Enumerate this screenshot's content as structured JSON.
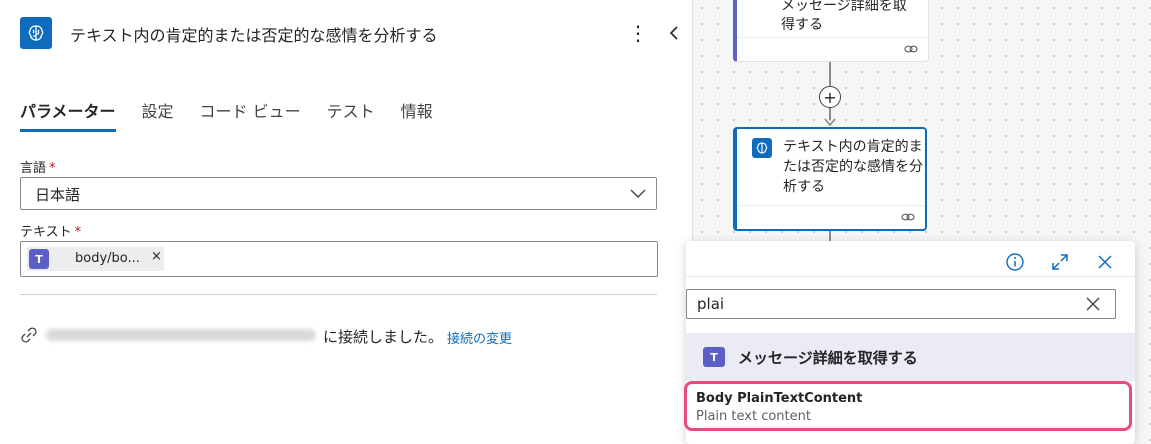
{
  "panel": {
    "title": "テキスト内の肯定的または否定的な感情を分析する",
    "more_label": "⋮",
    "tabs": [
      {
        "label": "パラメーター",
        "active": true
      },
      {
        "label": "設定",
        "active": false
      },
      {
        "label": "コード ビュー",
        "active": false
      },
      {
        "label": "テスト",
        "active": false
      },
      {
        "label": "情報",
        "active": false
      }
    ],
    "language": {
      "label": "言語",
      "required_mark": "*",
      "value": "日本語"
    },
    "text": {
      "label": "テキスト",
      "required_mark": "*",
      "token_label": "body/bo...",
      "token_close": "×",
      "token_icon": "T"
    },
    "connection": {
      "text": "に接続しました。",
      "change_link": "接続の変更"
    }
  },
  "canvas": {
    "card_top": {
      "line1": "メッセージ詳細を取",
      "line2": "得する"
    },
    "card_selected": {
      "text": "テキスト内の肯定的または否定的な感情を分析する"
    },
    "add_label": "+"
  },
  "popup": {
    "search_value": "plai",
    "group": {
      "icon": "T",
      "label": "メッセージ詳細を取得する"
    },
    "item": {
      "title": "Body PlainTextContent",
      "subtitle": "Plain text content"
    }
  },
  "colors": {
    "accent": "#0f6cbd",
    "teams": "#5b5fc7",
    "highlight": "#e84c7c",
    "required": "#c50f1f"
  }
}
